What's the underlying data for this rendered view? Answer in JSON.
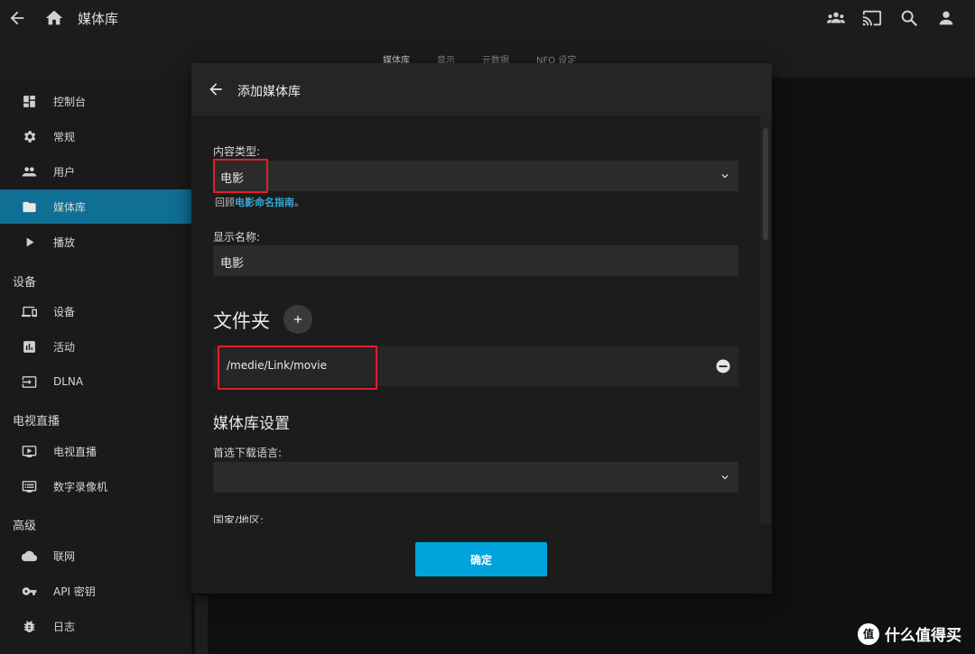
{
  "header": {
    "title": "媒体库",
    "tabs": [
      "媒体库",
      "显示",
      "元数据",
      "NFO 设定"
    ]
  },
  "sidebar": {
    "items": [
      {
        "label": "控制台",
        "icon": "dashboard-icon"
      },
      {
        "label": "常规",
        "icon": "gear-icon"
      },
      {
        "label": "用户",
        "icon": "users-icon"
      },
      {
        "label": "媒体库",
        "icon": "folder-icon",
        "active": true
      },
      {
        "label": "播放",
        "icon": "play-icon"
      }
    ],
    "sections": [
      {
        "title": "设备",
        "items": [
          {
            "label": "设备",
            "icon": "devices-icon"
          },
          {
            "label": "活动",
            "icon": "activity-icon"
          },
          {
            "label": "DLNA",
            "icon": "dlna-icon"
          }
        ]
      },
      {
        "title": "电视直播",
        "items": [
          {
            "label": "电视直播",
            "icon": "live-tv-icon"
          },
          {
            "label": "数字录像机",
            "icon": "dvr-icon"
          }
        ]
      },
      {
        "title": "高级",
        "items": [
          {
            "label": "联网",
            "icon": "cloud-icon"
          },
          {
            "label": "API 密钥",
            "icon": "key-icon"
          },
          {
            "label": "日志",
            "icon": "bug-icon"
          }
        ]
      }
    ]
  },
  "dialog": {
    "title": "添加媒体库",
    "content_type_label": "内容类型:",
    "content_type_value": "电影",
    "hint_prefix": "回顾",
    "hint_link": "电影命名指南",
    "hint_suffix": "。",
    "display_name_label": "显示名称:",
    "display_name_value": "电影",
    "folders_title": "文件夹",
    "folder_path": "/medie/Link/movie",
    "library_settings_title": "媒体库设置",
    "language_label": "首选下载语言:",
    "language_value": "",
    "country_label": "国家/地区:",
    "ok_label": "确定"
  },
  "watermark": {
    "badge": "值",
    "text": "什么值得买"
  },
  "colors": {
    "accent": "#00a4dc",
    "active_sidebar": "#0f6f95",
    "highlight_box": "#e0202a"
  }
}
